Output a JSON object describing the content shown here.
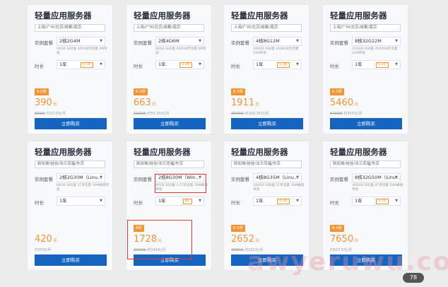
{
  "cards": [
    {
      "title": "轻量应用服务器",
      "region": "上海/广州/北京/成都/南京",
      "spec_label": "实例套餐",
      "spec": "2核2G4M",
      "spec_sub": "50GB SSD盘 300GB月流量 4M带宽",
      "dur_label": "时长",
      "dur": "1年",
      "disc_badge": "6.5折",
      "tag": "6.5折",
      "price": "390",
      "unit": "元",
      "orig_strike": "600元",
      "orig_rest": "约32.5元/月",
      "buy": "立即购买"
    },
    {
      "title": "轻量应用服务器",
      "region": "上海/广州/北京/成都/南京",
      "spec_label": "实例套餐",
      "spec": "2核4G6M",
      "spec_sub": "80GB SSD盘 600GB月流量 6M带宽",
      "dur_label": "时长",
      "dur": "1年",
      "disc_badge": "6.5折",
      "tag": "6.5折",
      "price": "663",
      "unit": "元",
      "orig_strike": "1020元",
      "orig_rest": "约55.25元/月",
      "buy": "立即购买"
    },
    {
      "title": "轻量应用服务器",
      "region": "上海/广州/北京/成都/南京",
      "spec_label": "实例套餐",
      "spec": "4核8G12M",
      "spec_sub": "180GB SSD盘 2000GB月流量 12M带宽",
      "dur_label": "时长",
      "dur": "1年",
      "disc_badge": "6.5折",
      "tag": "6.5折",
      "price": "1911",
      "unit": "元",
      "orig_strike": "2940元",
      "orig_rest": "约159.25元/月",
      "buy": "立即购买"
    },
    {
      "title": "轻量应用服务器",
      "region": "上海/广州/北京/成都/南京",
      "spec_label": "实例套餐",
      "spec": "8核32G22M",
      "spec_sub": "320GB SSD盘 4500GB月流量 22M带宽",
      "dur_label": "时长",
      "dur": "1年",
      "disc_badge": "6.5折",
      "tag": "6.5折",
      "price": "5460",
      "unit": "元",
      "orig_strike": "8400元",
      "orig_rest": "约455元/月",
      "buy": "立即购买"
    },
    {
      "title": "轻量应用服务器",
      "region": "新加坡/硅谷/法兰克福/东京",
      "spec_label": "实例套餐",
      "spec": "2核2G30M（Linu...",
      "spec_sub": "60GB SSD盘 1T月流量 30M峰值带宽",
      "dur_label": "时长",
      "dur": "1年",
      "disc_badge": "",
      "tag": "",
      "price": "420",
      "unit": "元",
      "orig_strike": "",
      "orig_rest": "约35元/月",
      "buy": "立即购买"
    },
    {
      "title": "轻量应用服务器",
      "region": "新加坡/硅谷/法兰克福/东京",
      "spec_label": "实例套餐",
      "spec": "2核8G30M（Win...",
      "spec_sub": "80GB SSD盘 2.5T月流量 30M峰值带宽",
      "dur_label": "时长",
      "dur": "1年",
      "disc_badge": "8折",
      "tag": "8折",
      "price": "1728",
      "unit": "元",
      "orig_strike": "2160元",
      "orig_rest": "约144元/月",
      "buy": "立即购买"
    },
    {
      "title": "轻量应用服务器",
      "region": "新加坡/硅谷/法兰克福/东京",
      "spec_label": "实例套餐",
      "spec": "4核8G35M（Linu...",
      "spec_sub": "180GB SSD盘 5T月流量 35M峰值带宽",
      "dur_label": "时长",
      "dur": "1年",
      "disc_badge": "6.5折",
      "tag": "6.5折",
      "price": "2652",
      "unit": "元",
      "orig_strike": "4080元",
      "orig_rest": "约221元/月",
      "buy": "立即购买"
    },
    {
      "title": "轻量应用服务器",
      "region": "新加坡/硅谷/法兰克福/东京",
      "spec_label": "实例套餐",
      "spec": "8核32G50M（Linu...",
      "spec_sub": "300GB SSD盘 8T月流量 50M峰值带宽",
      "dur_label": "时长",
      "dur": "1年",
      "disc_badge": "6.5折",
      "tag": "6.5折",
      "price": "7650",
      "unit": "元",
      "orig_strike": "",
      "orig_rest": "约637.5元/月",
      "buy": "立即购买"
    }
  ],
  "watermark": "awyeruwu.com",
  "corner_badge": "78"
}
